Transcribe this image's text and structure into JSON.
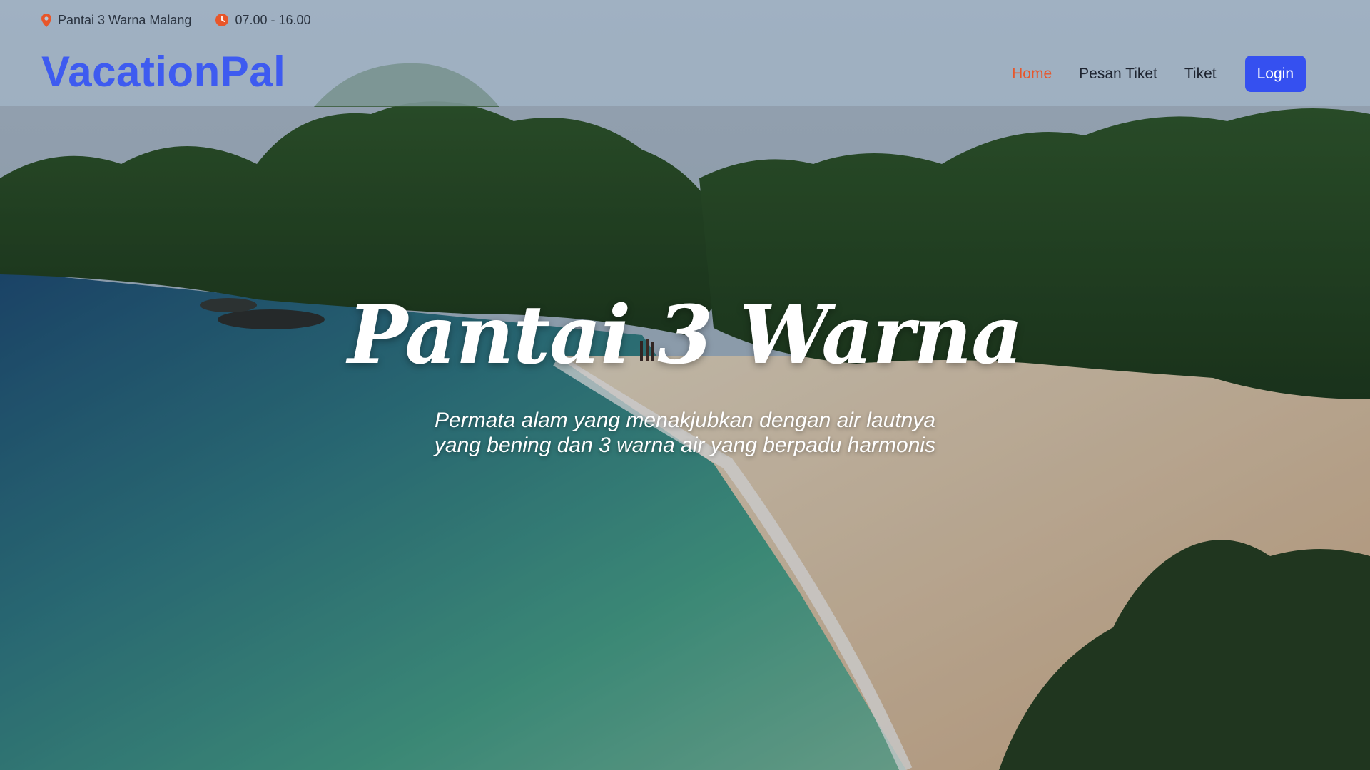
{
  "topbar": {
    "location": "Pantai 3 Warna Malang",
    "hours": "07.00 - 16.00"
  },
  "brand": "VacationPal",
  "nav": {
    "items": [
      {
        "label": "Home",
        "active": true
      },
      {
        "label": "Pesan Tiket",
        "active": false
      },
      {
        "label": "Tiket",
        "active": false
      }
    ],
    "login": "Login"
  },
  "hero": {
    "title": "Pantai 3 Warna",
    "subtitle_line1": "Permata alam yang menakjubkan dengan air lautnya",
    "subtitle_line2": "yang bening dan 3 warna air yang berpadu harmonis"
  },
  "colors": {
    "brand": "#3e5bf0",
    "active_nav": "#e8562a",
    "login_bg": "#3550f0",
    "icon_accent": "#e8562a"
  },
  "icons": {
    "location": "map-pin-icon",
    "hours": "clock-icon"
  }
}
